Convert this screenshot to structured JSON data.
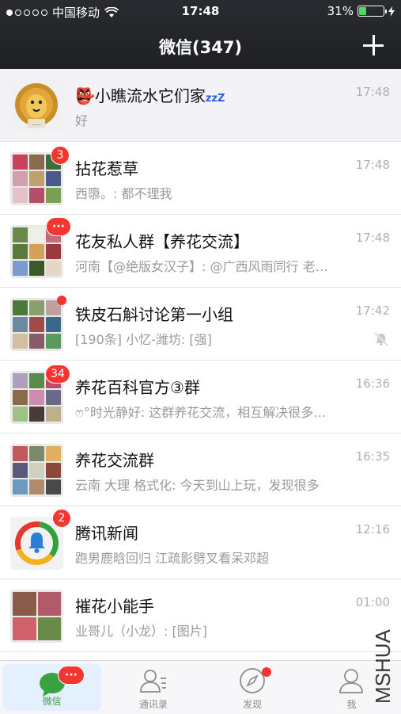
{
  "status_bar": {
    "carrier": "中国移动",
    "time": "17:48",
    "battery": "31%",
    "battery_level": 0.31
  },
  "nav": {
    "title": "微信(347)",
    "add_icon": "plus-icon"
  },
  "chats": [
    {
      "title": "👺小瞧流水它们家",
      "title_suffix": "zzZ",
      "time": "17:48",
      "preview": "好",
      "badge": "",
      "reddot": false,
      "muted": false,
      "pinned": true
    },
    {
      "title": "拈花惹草",
      "time": "17:48",
      "preview": "西隳。: 都不理我",
      "badge": "3",
      "reddot": false,
      "muted": false,
      "pinned": false
    },
    {
      "title": "花友私人群【养花交流】",
      "time": "17:48",
      "preview": "河南【@绝版女汉子】: @广西风雨同行 老…",
      "badge": "···",
      "reddot": false,
      "muted": false,
      "pinned": false
    },
    {
      "title": "铁皮石斛讨论第一小组",
      "time": "17:42",
      "preview": "[190条] 小忆-潍坊: [强]",
      "badge": "",
      "reddot": true,
      "muted": true,
      "pinned": false
    },
    {
      "title": "养花百科官方③群",
      "time": "16:36",
      "preview": "ෆ°时光静好: 这群养花交流，相互解决很多…",
      "badge": "34",
      "reddot": false,
      "muted": false,
      "pinned": false
    },
    {
      "title": "养花交流群",
      "time": "16:35",
      "preview": "云南 大理 格式化: 今天到山上玩，发现很多",
      "badge": "",
      "reddot": false,
      "muted": false,
      "pinned": false
    },
    {
      "title": "腾讯新闻",
      "time": "12:16",
      "preview": "跑男鹿晗回归 江疏影劈叉看呆邓超",
      "badge": "2",
      "reddot": false,
      "muted": false,
      "pinned": false
    },
    {
      "title": "摧花小能手",
      "time": "01:00",
      "preview": "业哥儿（小龙）: [图片]",
      "badge": "",
      "reddot": false,
      "muted": false,
      "pinned": false
    }
  ],
  "tabbar": {
    "tabs": [
      {
        "label": "微信",
        "icon": "chat-bubble-icon",
        "badge": "···"
      },
      {
        "label": "通讯录",
        "icon": "contacts-icon"
      },
      {
        "label": "发现",
        "icon": "compass-icon"
      },
      {
        "label": "我",
        "icon": "person-icon"
      }
    ]
  },
  "watermark": "MSHUA",
  "colors": {
    "nav_bg": "#26272b",
    "badge_red": "#f43530",
    "active_green": "#3aa140",
    "battery_green": "#4cd964"
  }
}
